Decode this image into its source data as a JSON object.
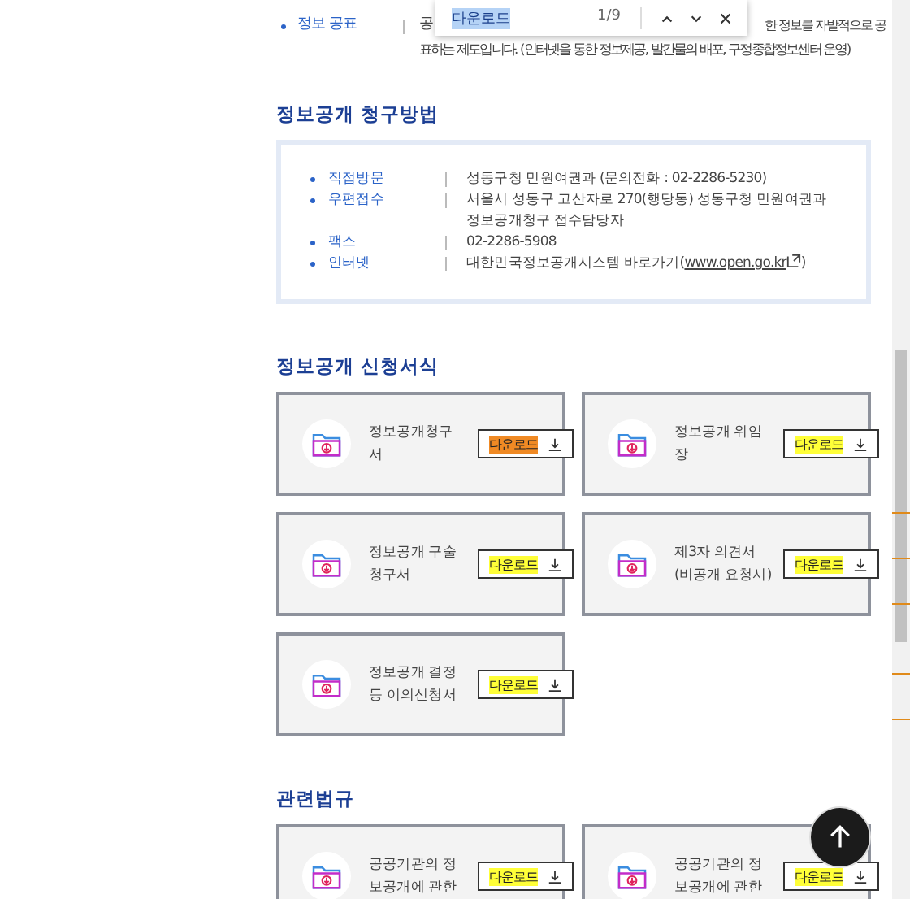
{
  "find_bar": {
    "query": "다운로드",
    "count": "1/9"
  },
  "disclosure": {
    "label": "정보 공표",
    "text_start": "공",
    "text_line1_end": "한 정보를 자발적으로 공",
    "text_line2": "표하는 제도입니다. (인터넷을 통한 정보제공, 발간물의 배포, 구정종합정보센터 운영)"
  },
  "request_methods": {
    "heading": "정보공개 청구방법",
    "items": [
      {
        "label": "직접방문",
        "value": "성동구청 민원여권과 (문의전화 : 02-2286-5230)"
      },
      {
        "label": "우편접수",
        "value": "서울시 성동구 고산자로 270(행당동) 성동구청 민원여권과 정보공개청구 접수담당자"
      },
      {
        "label": "팩스",
        "value": "02-2286-5908"
      },
      {
        "label": "인터넷",
        "value": "대한민국정보공개시스템 바로가기(",
        "link": "www.open.go.kr",
        "value_end": ")"
      }
    ]
  },
  "forms": {
    "heading": "정보공개 신청서식",
    "items": [
      {
        "title": "정보공개청구서",
        "button": "다운로드",
        "current": true
      },
      {
        "title": "정보공개 위임장",
        "button": "다운로드",
        "current": false
      },
      {
        "title": "정보공개 구술청구서",
        "button": "다운로드",
        "current": false
      },
      {
        "title": "제3자 의견서 (비공개 요청시)",
        "button": "다운로드",
        "current": false
      },
      {
        "title": "정보공개 결정 등 이의신청서",
        "button": "다운로드",
        "current": false
      }
    ]
  },
  "laws": {
    "heading": "관련법규",
    "items": [
      {
        "title": "공공기관의 정보공개에 관한",
        "button": "다운로드",
        "current": false
      },
      {
        "title": "공공기관의 정보공개에 관한",
        "button": "다운로드",
        "current": false
      }
    ]
  }
}
